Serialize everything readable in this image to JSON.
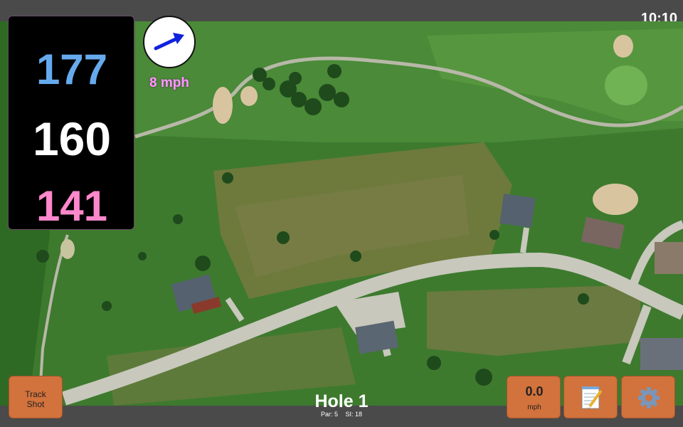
{
  "status_bar": {
    "time": "10:10"
  },
  "distances": {
    "back": "177",
    "middle": "160",
    "front": "141"
  },
  "wind": {
    "speed_label": "8 mph",
    "direction_icon": "wind-arrow-icon"
  },
  "hole": {
    "title": "Hole 1",
    "par_label": "Par: 5",
    "si_label": "SI: 18"
  },
  "buttons": {
    "track_shot_line1": "Track",
    "track_shot_line2": "Shot",
    "speed_value": "0.0",
    "speed_unit": "mph",
    "notes_icon": "notepad-icon",
    "settings_icon": "gear-icon"
  },
  "colors": {
    "back_distance": "#66aaee",
    "middle_distance": "#ffffff",
    "front_distance": "#ff88cc",
    "wind_speed": "#ff99ff",
    "button_bg": "#d2723c"
  }
}
